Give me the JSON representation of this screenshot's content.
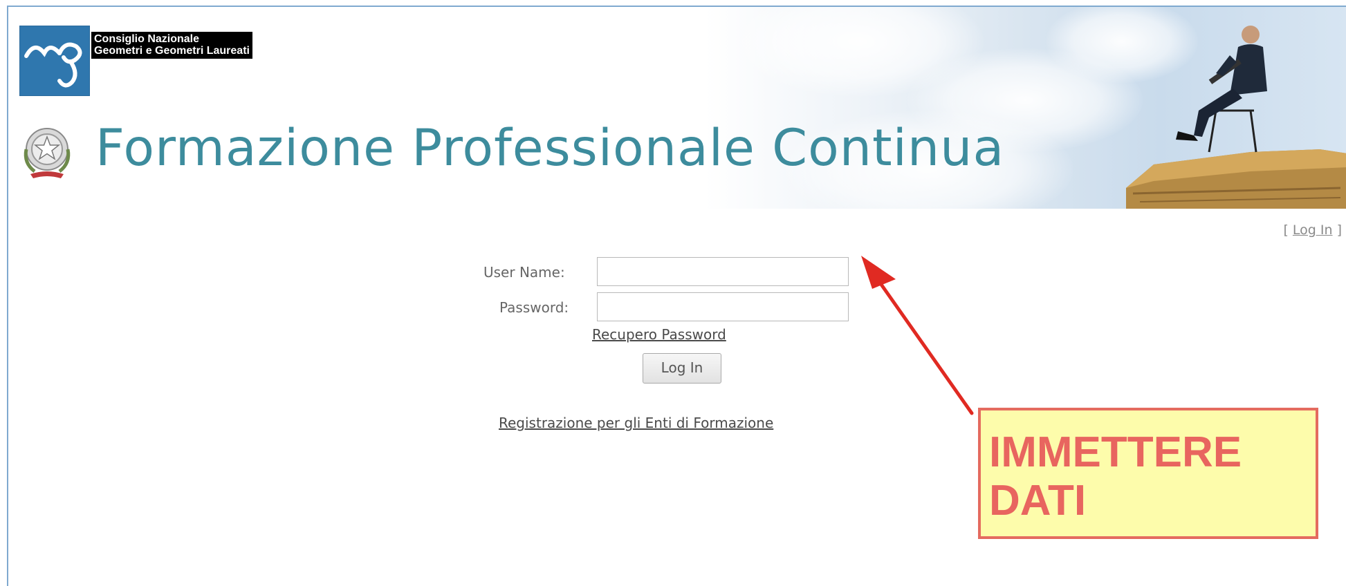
{
  "header": {
    "organization_line1": "Consiglio Nazionale",
    "organization_line2": "Geometri e Geometri Laureati",
    "title": "Formazione Professionale Continua"
  },
  "top_login": {
    "open": "[",
    "label": "Log In",
    "close": "]"
  },
  "form": {
    "username_label": "User Name:",
    "username_value": "",
    "password_label": "Password:",
    "password_value": "",
    "recover_label": "Recupero Password",
    "login_button": "Log In",
    "register_label": "Registrazione per gli Enti di Formazione"
  },
  "annotation": {
    "text": "IMMETTERE\nDATI"
  },
  "colors": {
    "title": "#3d8c9d",
    "logo_blue": "#2f77ae",
    "annotation_red": "#e8655f",
    "annotation_fill": "#fdfcab"
  },
  "icons": {
    "logo": "cng-logo",
    "emblem": "italian-republic-emblem",
    "header_photo": "man-with-laptop-on-rock",
    "annotation": "red-arrow"
  }
}
